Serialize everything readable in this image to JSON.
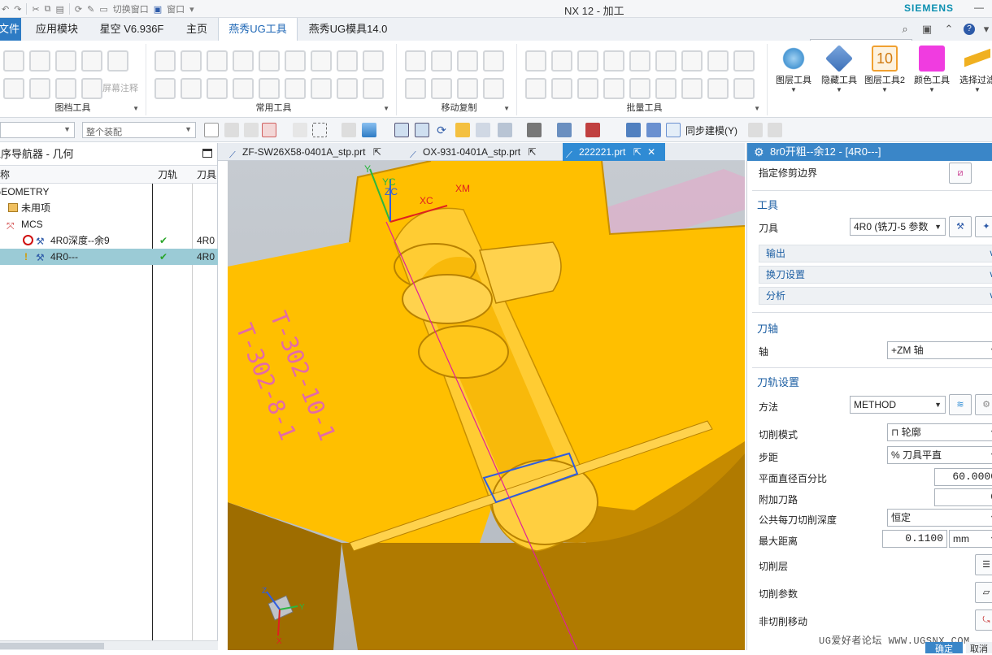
{
  "app": {
    "title": "NX 12 - 加工",
    "brand": "SIEMENS",
    "quick_access_window_switch": "切换窗口",
    "quick_access_window": "窗口"
  },
  "tabs": [
    {
      "label": "文件"
    },
    {
      "label": "应用模块"
    },
    {
      "label": "星空 V6.936F"
    },
    {
      "label": "主页"
    },
    {
      "label": "燕秀UG工具"
    },
    {
      "label": "燕秀UG模具14.0"
    }
  ],
  "command_search": {
    "placeholder": "查找命令"
  },
  "ribbon": {
    "groups": [
      {
        "label": "图档工具"
      },
      {
        "label": "常用工具"
      },
      {
        "label": "移动复制"
      },
      {
        "label": "批量工具"
      }
    ],
    "screen_annotation": "屏幕注释",
    "big_buttons": [
      {
        "label": "图层工具",
        "color": "#4a98d4"
      },
      {
        "label": "隐藏工具",
        "color": "#3c6fb7"
      },
      {
        "label": "图层工具2",
        "badge": "10",
        "color": "#f0a030"
      },
      {
        "label": "颜色工具",
        "color": "#f03ce0"
      },
      {
        "label": "选择过滤",
        "color": "#f0b020"
      }
    ]
  },
  "selection_bar": {
    "filter_value": "",
    "assembly_scope": "整个装配",
    "sync_modeling": "同步建模(Y)"
  },
  "navigator": {
    "title": "工序导航器 - 几何",
    "columns": {
      "name": "名称",
      "path": "刀轨",
      "tool": "刀具"
    },
    "rows": [
      {
        "name": "GEOMETRY",
        "path": "",
        "tool": ""
      },
      {
        "name": "未用项",
        "path": "",
        "tool": ""
      },
      {
        "name": "MCS",
        "path": "",
        "tool": ""
      },
      {
        "name": "4R0深度--余9",
        "path": "✔",
        "tool": "4R0"
      },
      {
        "name": "4R0---",
        "path": "✔",
        "tool": "4R0"
      }
    ]
  },
  "file_tabs": [
    {
      "label": "ZF-SW26X58-0401A_stp.prt"
    },
    {
      "label": "OX-931-0401A_stp.prt"
    },
    {
      "label": "222221.prt"
    }
  ],
  "viewport": {
    "engraving_1": "T-302-10-1",
    "engraving_2": "T-302-8-1",
    "axis_yc": "YC",
    "axis_zc": "ZC",
    "axis_xc": "XC",
    "axis_xm": "XM",
    "axis_y_top": "Y",
    "triad_x": "X",
    "triad_y": "Y",
    "triad_z": "Z",
    "part_color": "#ffbf00"
  },
  "dialog": {
    "title": "8r0开粗--余12 - [4R0---]",
    "trim_boundary": "指定修剪边界",
    "tool_section": "工具",
    "tool_label": "刀具",
    "tool_value": "4R0 (铣刀-5 参数",
    "output": "输出",
    "tool_change": "换刀设置",
    "analysis": "分析",
    "axis_section": "刀轴",
    "axis_label": "轴",
    "axis_value": "+ZM 轴",
    "path_section": "刀轨设置",
    "method_label": "方法",
    "method_value": "METHOD",
    "cut_pattern_label": "切削模式",
    "cut_pattern_value": "轮廓",
    "stepover_label": "步距",
    "stepover_value": "% 刀具平直",
    "flat_percent_label": "平面直径百分比",
    "flat_percent_value": "60.0000",
    "extra_passes_label": "附加刀路",
    "extra_passes_value": "0",
    "common_depth_label": "公共每刀切削深度",
    "common_depth_value": "恒定",
    "max_distance_label": "最大距离",
    "max_distance_value": "0.1100",
    "max_distance_unit": "mm",
    "cut_levels_label": "切削层",
    "cut_params_label": "切削参数",
    "non_cut_moves_label": "非切削移动",
    "ok": "确定",
    "cancel": "取消"
  },
  "watermark": "UG爱好者论坛 WWW.UGSNX.COM"
}
